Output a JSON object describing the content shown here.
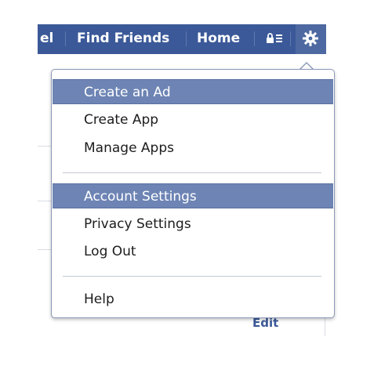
{
  "topnav": {
    "partial_label": "el",
    "find_friends": "Find Friends",
    "home": "Home",
    "account_icon": "account-list-icon",
    "settings_icon": "gear-icon"
  },
  "menu": {
    "group1": [
      "Create an Ad",
      "Create App",
      "Manage Apps"
    ],
    "group2": [
      "Account Settings",
      "Privacy Settings",
      "Log Out"
    ],
    "group3": [
      "Help"
    ]
  },
  "background": {
    "edit_link": "Edit"
  },
  "colors": {
    "nav_blue": "#3b5998",
    "highlight": "#6d84b4"
  }
}
